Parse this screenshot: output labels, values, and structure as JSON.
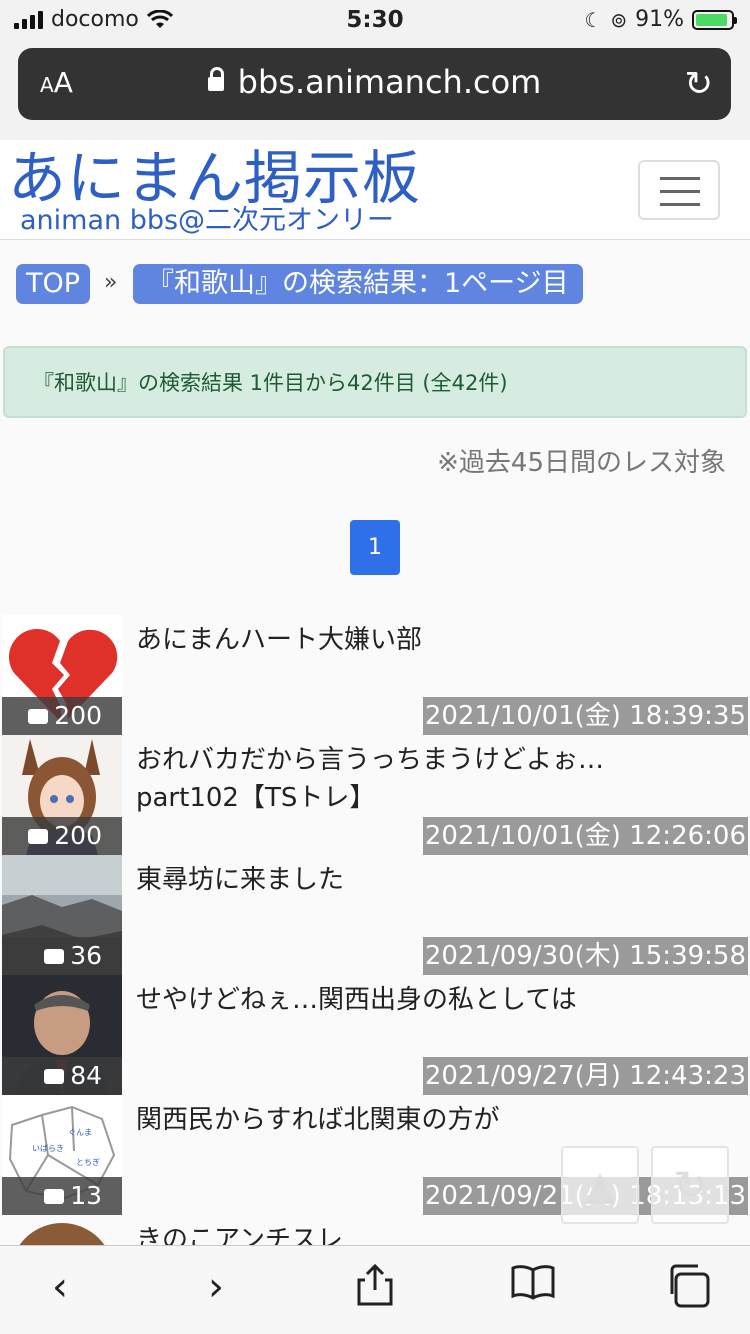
{
  "status": {
    "carrier": "docomo",
    "time": "5:30",
    "battery": "91%"
  },
  "browser": {
    "aa": "AA",
    "host": "bbs.animanch.com"
  },
  "site": {
    "logo": "あにまん掲示板",
    "subtitle": "animan bbs@二次元オンリー"
  },
  "breadcrumb": {
    "top": "TOP",
    "sep": "»",
    "current": "『和歌山』の検索結果：1ページ目"
  },
  "alert": "『和歌山』の検索結果 1件目から42件目 (全42件)",
  "note": "※過去45日間のレス対象",
  "pagination": {
    "current": "1"
  },
  "threads": [
    {
      "title": "あにまんハート大嫌い部",
      "count": "200",
      "date": "2021/10/01(金) 18:39:35",
      "thumb": "broken-heart"
    },
    {
      "title": "おれバカだから言うっちまうけどよぉ… part102【TSトレ】",
      "count": "200",
      "date": "2021/10/01(金) 12:26:06",
      "thumb": "horse-girl"
    },
    {
      "title": "東尋坊に来ました",
      "count": "36",
      "date": "2021/09/30(木) 15:39:58",
      "thumb": "cliff"
    },
    {
      "title": "せやけどねぇ…関西出身の私としては",
      "count": "84",
      "date": "2021/09/27(月) 12:43:23",
      "thumb": "man-in-suit"
    },
    {
      "title": "関西民からすれば北関東の方が",
      "count": "13",
      "date": "2021/09/21(火) 18:13:13",
      "thumb": "map"
    },
    {
      "title": "きのこアンチスレ",
      "count": "",
      "date": "",
      "thumb": "brown-circle"
    }
  ],
  "colors": {
    "accent": "#2f6fe8",
    "logo": "#2d5fc4",
    "breadcrumb": "#5f85e0",
    "alert_bg": "#d7ece0"
  }
}
